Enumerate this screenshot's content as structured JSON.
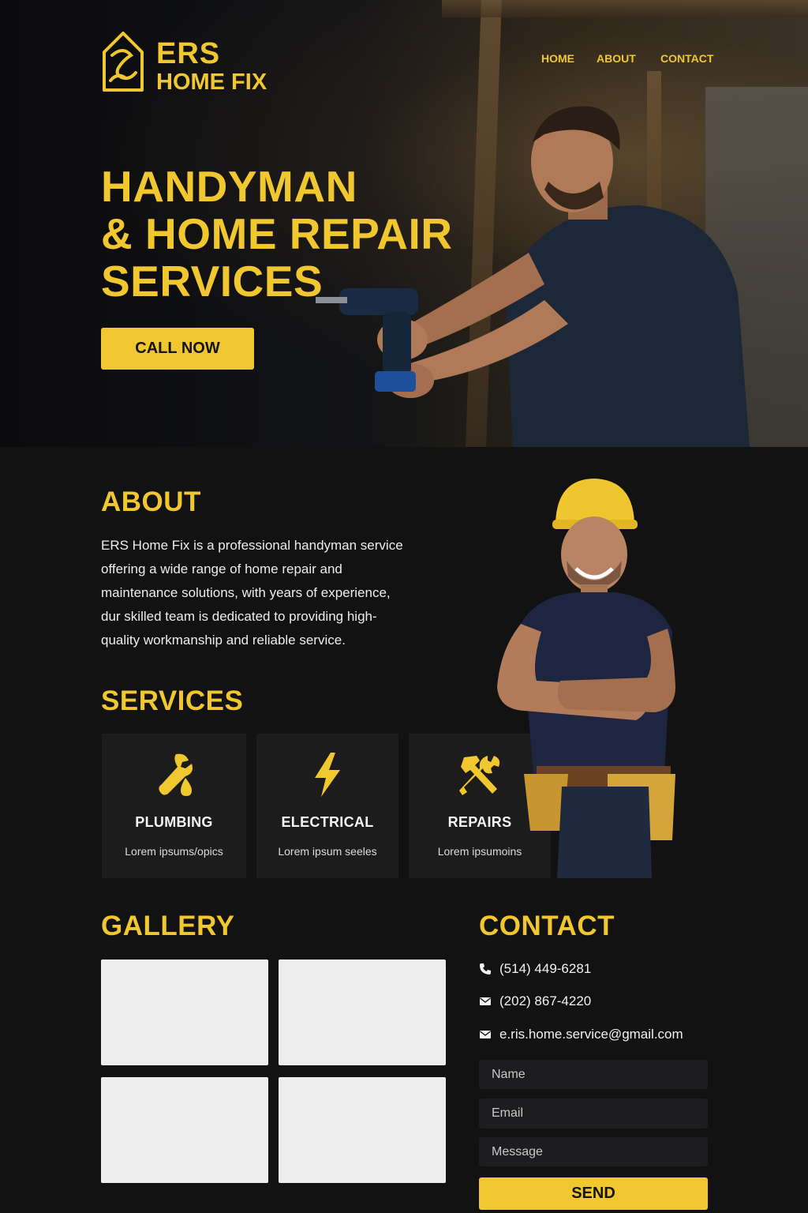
{
  "brand": {
    "name_line1": "ERS",
    "name_line2": "HOME FIX",
    "accent_color": "#f1c72f",
    "background_color": "#121212"
  },
  "nav": {
    "items": [
      "HOME",
      "ABOUT",
      "CONTACT"
    ]
  },
  "hero": {
    "title_lines": [
      "HANDYMAN",
      "& HOME REPAIR",
      "SERVICES"
    ],
    "cta_label": "CALL NOW"
  },
  "about": {
    "heading": "ABOUT",
    "text_lines": [
      "ERS Home Fix is a professional handyman service",
      "offering a wide range of home repair and",
      "maintenance solutions, with years of experience,",
      "dur skilled team is dedicated to providing high-",
      "quality workmanship and reliable service."
    ]
  },
  "services": {
    "heading": "SERVICES",
    "items": [
      {
        "icon": "wrench-drop-icon",
        "title": "PLUMBING",
        "desc": "Lorem ipsums/opics"
      },
      {
        "icon": "lightning-bolt-icon",
        "title": "ELECTRICAL",
        "desc": "Lorem ipsum seeles"
      },
      {
        "icon": "hammer-wrench-icon",
        "title": "REPAIRS",
        "desc": "Lorem ipsumoins"
      }
    ]
  },
  "gallery": {
    "heading": "GALLERY"
  },
  "contact": {
    "heading": "CONTACT",
    "phone1": "(514) 449-6281",
    "phone2": "(202) 867-4220",
    "email": "e.ris.home.service@gmail.com",
    "name_placeholder": "Name",
    "email_placeholder": "Email",
    "message_placeholder": "Message",
    "send_label": "SEND"
  }
}
